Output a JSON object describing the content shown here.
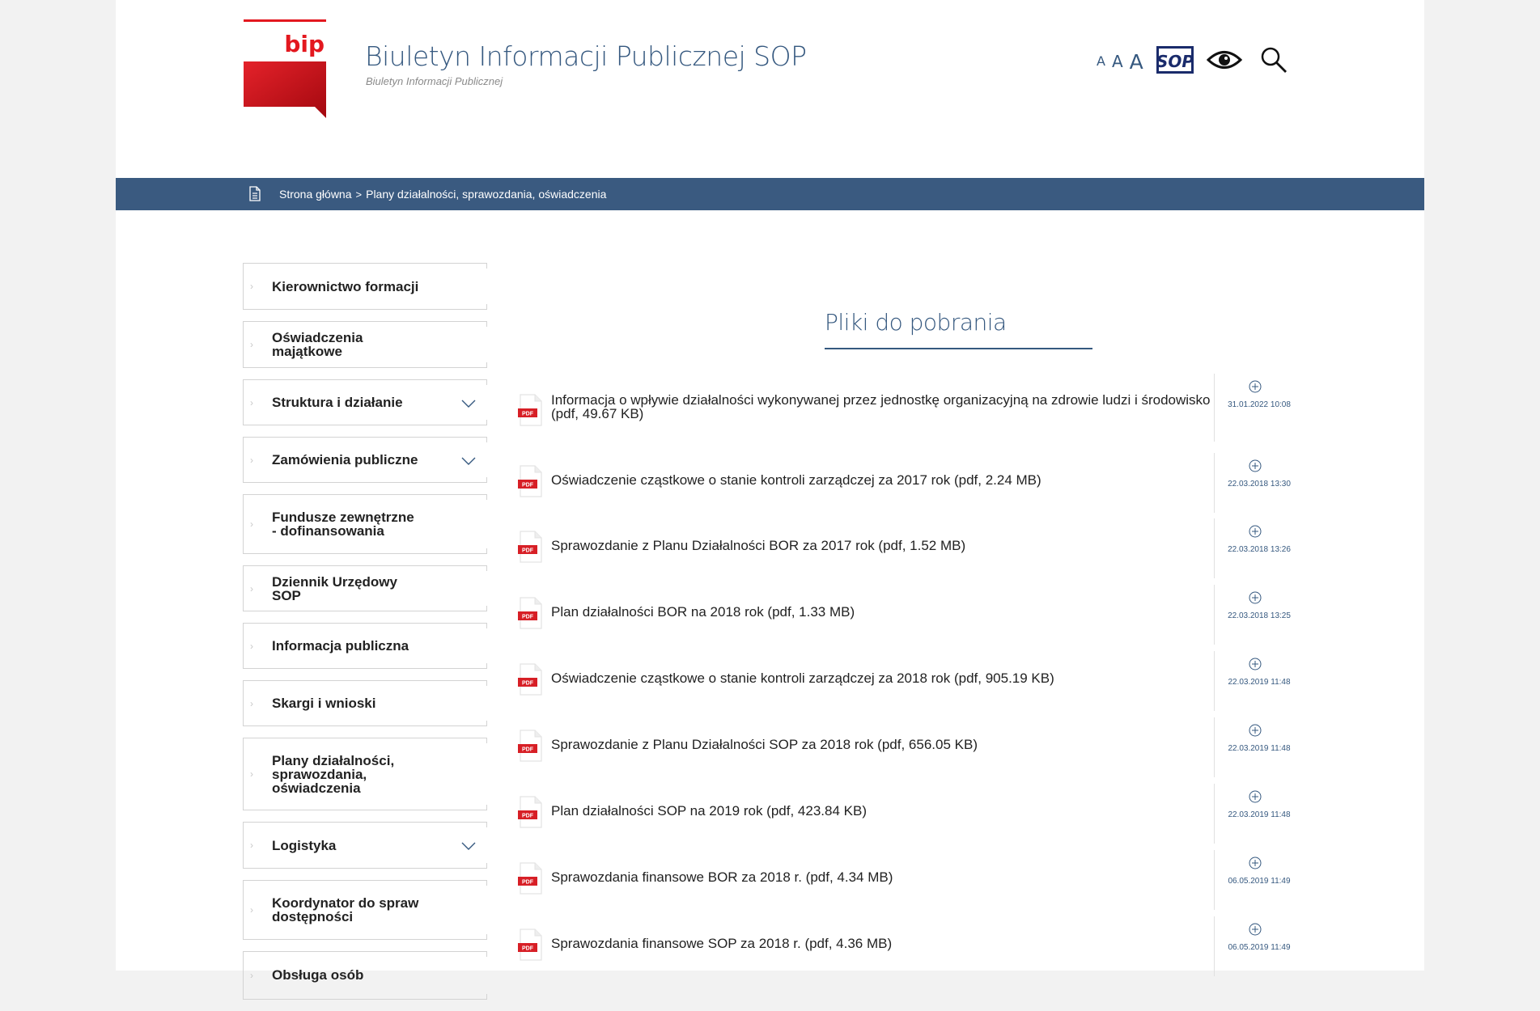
{
  "header": {
    "logo_text": "bip",
    "title": "Biuletyn Informacji Publicznej SOP",
    "subtitle": "Biuletyn Informacji Publicznej",
    "font_small": "A",
    "font_medium": "A",
    "font_large": "A",
    "sop_logo_text": "SOP",
    "icons": [
      "sop-logo-icon",
      "eye-icon",
      "search-icon"
    ]
  },
  "breadcrumb": {
    "home": "Strona główna",
    "separator": ">",
    "current": "Plany działalności, sprawozdania, oświadczenia"
  },
  "sidebar": {
    "items": [
      {
        "label": "Kierownictwo formacji",
        "expandable": false
      },
      {
        "label": "Oświadczenia majątkowe",
        "expandable": false
      },
      {
        "label": "Struktura i działanie",
        "expandable": true
      },
      {
        "label": "Zamówienia publiczne",
        "expandable": true
      },
      {
        "label": "Fundusze zewnętrzne - dofinansowania",
        "expandable": false
      },
      {
        "label": "Dziennik Urzędowy SOP",
        "expandable": false
      },
      {
        "label": "Informacja publiczna",
        "expandable": false
      },
      {
        "label": "Skargi i wnioski",
        "expandable": false
      },
      {
        "label": "Plany działalności, sprawozdania, oświadczenia",
        "expandable": false
      },
      {
        "label": "Logistyka",
        "expandable": true
      },
      {
        "label": "Koordynator do spraw dostępności",
        "expandable": false
      },
      {
        "label": "Obsługa osób",
        "expandable": false
      }
    ]
  },
  "main": {
    "heading": "Pliki do pobrania",
    "pdf_badge": "PDF",
    "files": [
      {
        "name": "Informacja o wpływie działalności wykonywanej przez jednostkę organizacyjną na zdrowie ludzi i środowisko (pdf, 49.67 KB)",
        "date": "31.01.2022 10:08"
      },
      {
        "name": "Oświadczenie cząstkowe o stanie kontroli zarządczej za 2017 rok (pdf, 2.24 MB)",
        "date": "22.03.2018 13:30"
      },
      {
        "name": "Sprawozdanie z Planu Działalności BOR za 2017 rok (pdf, 1.52 MB)",
        "date": "22.03.2018 13:26"
      },
      {
        "name": "Plan działalności BOR na 2018 rok (pdf, 1.33 MB)",
        "date": "22.03.2018 13:25"
      },
      {
        "name": "Oświadczenie cząstkowe o stanie kontroli zarządczej za 2018 rok (pdf, 905.19 KB)",
        "date": "22.03.2019 11:48"
      },
      {
        "name": "Sprawozdanie z Planu Działalności SOP za 2018 rok (pdf, 656.05 KB)",
        "date": "22.03.2019 11:48"
      },
      {
        "name": "Plan działalności SOP na 2019 rok (pdf, 423.84 KB)",
        "date": "22.03.2019 11:48"
      },
      {
        "name": "Sprawozdania finansowe BOR za 2018 r. (pdf, 4.34 MB)",
        "date": "06.05.2019 11:49"
      },
      {
        "name": "Sprawozdania finansowe SOP za 2018 r. (pdf, 4.36 MB)",
        "date": "06.05.2019 11:49"
      }
    ]
  },
  "colors": {
    "brand_blue": "#35587f",
    "bar_blue": "#3a5a80",
    "bip_red": "#e3181f"
  }
}
